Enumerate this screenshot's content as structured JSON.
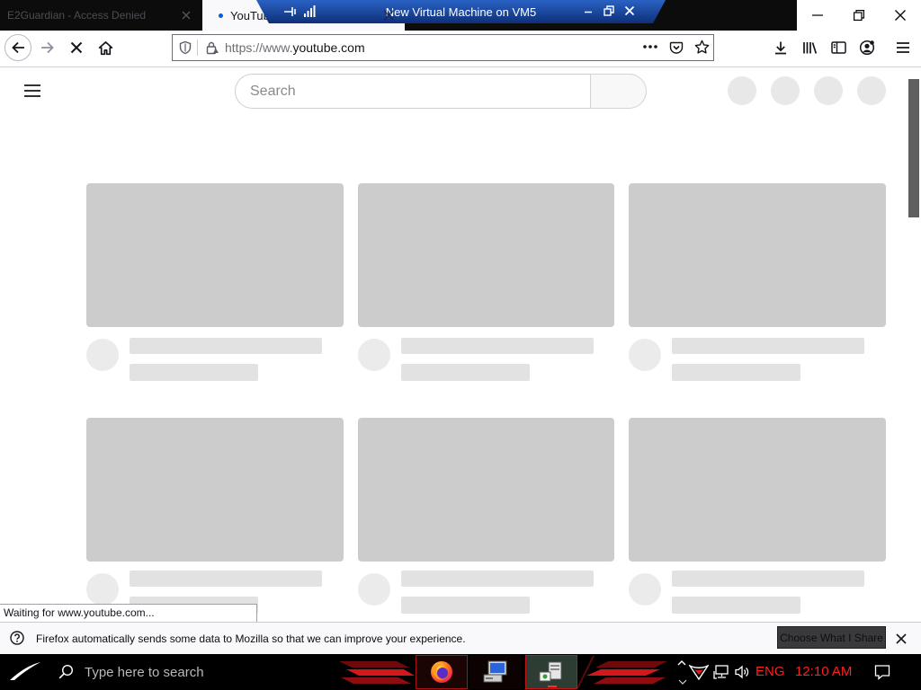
{
  "browser": {
    "tabs": [
      {
        "label": "E2Guardian - Access Denied",
        "active": false
      },
      {
        "label": "YouTube",
        "active": true,
        "loading": true
      }
    ],
    "url": {
      "prefix": "https://www.",
      "domain": "youtube.com"
    },
    "status_text": "Waiting for www.youtube.com...",
    "toolbar_icons": [
      "back-icon",
      "forward-icon",
      "stop-icon",
      "home-icon",
      "download-icon",
      "library-icon",
      "sidebar-icon",
      "account-icon",
      "menu-icon"
    ],
    "urlbar_icons": [
      "shield-icon",
      "lock-icon",
      "page-actions-icon",
      "pocket-icon",
      "bookmark-star-icon"
    ]
  },
  "vm_bar": {
    "title": "New Virtual Machine on VM5",
    "icons": [
      "pin-icon",
      "signal-icon",
      "minimize-icon",
      "restore-icon",
      "close-icon"
    ]
  },
  "page": {
    "search_placeholder": "Search"
  },
  "notification": {
    "message": "Firefox automatically sends some data to Mozilla so that we can improve your experience.",
    "button_label": "Choose What I Share"
  },
  "taskbar": {
    "search_placeholder": "Type here to search",
    "language": "ENG",
    "clock": "12:10 AM",
    "apps": [
      "firefox-icon",
      "computer-icon",
      "vm-console-icon"
    ]
  },
  "colors": {
    "tab_strip": "#0c0c0d",
    "vm_bar": "#1c4fae",
    "skeleton_thumbnail": "#cccccc",
    "skeleton_text": "#e2e2e2",
    "taskbar": "#000000",
    "tray_text": "#ff1f1f"
  }
}
